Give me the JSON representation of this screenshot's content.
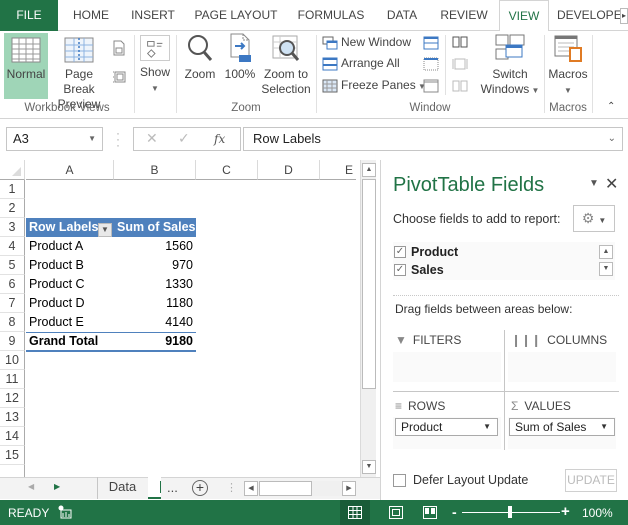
{
  "ribbon_tabs": [
    {
      "label": "FILE"
    },
    {
      "label": "HOME"
    },
    {
      "label": "INSERT"
    },
    {
      "label": "PAGE LAYOUT"
    },
    {
      "label": "FORMULAS"
    },
    {
      "label": "DATA"
    },
    {
      "label": "REVIEW"
    },
    {
      "label": "VIEW"
    },
    {
      "label": "DEVELOPE"
    }
  ],
  "active_tab": "VIEW",
  "ribbon": {
    "workbook_views": {
      "label": "Workbook Views",
      "normal": "Normal",
      "page_break_line1": "Page Break",
      "page_break_line2": "Preview"
    },
    "show": {
      "label": "Show"
    },
    "zoom": {
      "label": "Zoom",
      "zoom": "Zoom",
      "hundred": "100%",
      "zoom_to_line1": "Zoom to",
      "zoom_to_line2": "Selection"
    },
    "window": {
      "label": "Window",
      "new_window": "New Window",
      "arrange_all": "Arrange All",
      "freeze_panes": "Freeze Panes",
      "switch_line1": "Switch",
      "switch_line2": "Windows"
    },
    "macros": {
      "label": "Macros",
      "button": "Macros"
    }
  },
  "formula_bar": {
    "name_box": "A3",
    "fx": "fx",
    "value": "Row Labels"
  },
  "grid": {
    "columns": [
      "A",
      "B",
      "C",
      "D",
      "E"
    ],
    "rows": [
      "1",
      "2",
      "3",
      "4",
      "5",
      "6",
      "7",
      "8",
      "9",
      "10",
      "11",
      "12",
      "13",
      "14",
      "15"
    ],
    "pivot": {
      "header_label": "Row Labels",
      "header_value": "Sum of Sales",
      "items": [
        {
          "label": "Product A",
          "value": "1560"
        },
        {
          "label": "Product B",
          "value": "970"
        },
        {
          "label": "Product C",
          "value": "1330"
        },
        {
          "label": "Product D",
          "value": "1180"
        },
        {
          "label": "Product E",
          "value": "4140"
        }
      ],
      "total_label": "Grand Total",
      "total_value": "9180"
    }
  },
  "sheet_tabs": {
    "sheets": [
      "Data"
    ],
    "more": "...",
    "add": "+"
  },
  "pivot_pane": {
    "title": "PivotTable Fields",
    "choose_label": "Choose fields to add to report:",
    "fields": [
      {
        "name": "Product",
        "checked": true
      },
      {
        "name": "Sales",
        "checked": true
      }
    ],
    "drag_label": "Drag fields between areas below:",
    "areas": {
      "filters": "FILTERS",
      "columns": "COLUMNS",
      "rows": "ROWS",
      "values": "VALUES",
      "rows_field": "Product",
      "values_field": "Sum of Sales"
    },
    "defer_label": "Defer Layout Update",
    "update_label": "UPDATE"
  },
  "status_bar": {
    "status": "READY",
    "zoom_percent": "100%",
    "zoom_level": 100
  },
  "colors": {
    "excel_green": "#217346",
    "pivot_header": "#4f81bd"
  }
}
